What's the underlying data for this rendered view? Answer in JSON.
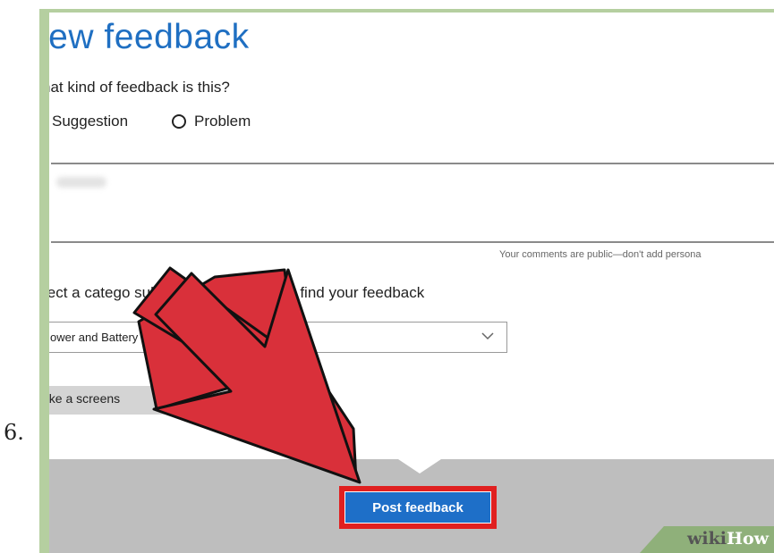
{
  "step": {
    "number": "6."
  },
  "window": {
    "title": "lew feedback",
    "question": "hat kind of feedback is this?",
    "options": [
      {
        "label": "Suggestion",
        "selected": true
      },
      {
        "label": "Problem",
        "selected": false
      }
    ],
    "public_note": "Your comments are public—don't add persona",
    "category_prompt": "lect a catego        subcate   ry to help users find your feedback",
    "category_value": "ower and Battery",
    "screenshot_label": "ake a screens"
  },
  "footer": {
    "post_button_label": "Post feedback"
  },
  "watermark": {
    "wiki": "wiki",
    "how": "How"
  },
  "colors": {
    "accent": "#1f6fc2",
    "button": "#1e6fc8",
    "highlight": "#e02020",
    "arrow": "#d9303a",
    "frame": "#b5cfa0"
  }
}
